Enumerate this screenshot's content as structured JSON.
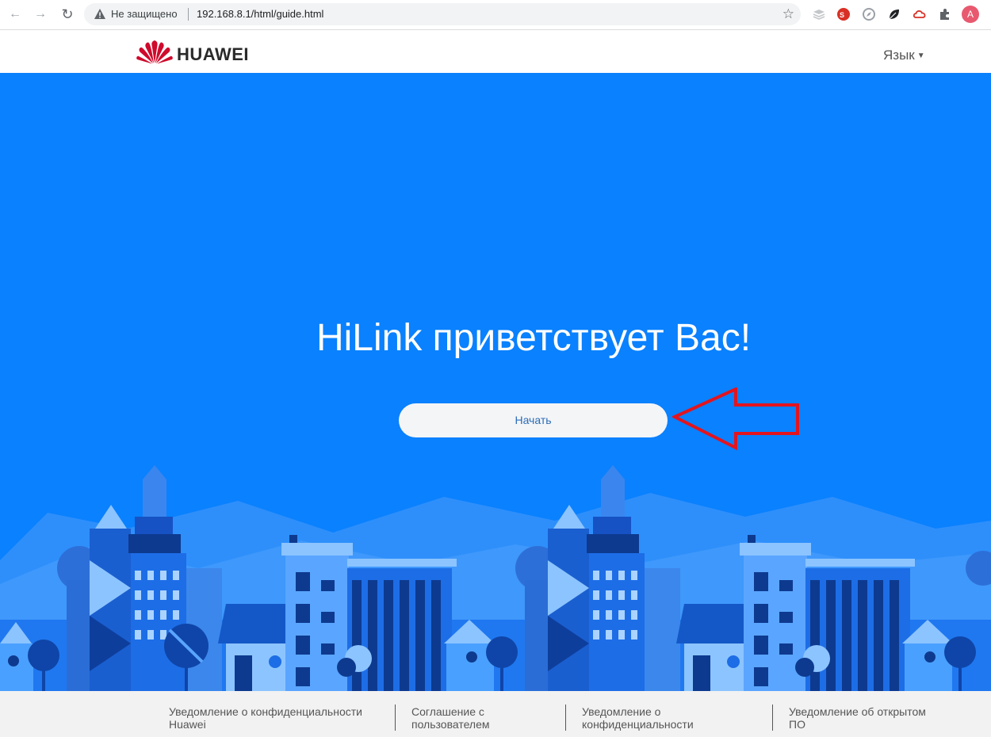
{
  "browser": {
    "security_status": "Не защищено",
    "url": "192.168.8.1/html/guide.html",
    "avatar_letter": "A"
  },
  "header": {
    "brand": "HUAWEI",
    "language_label": "Язык"
  },
  "hero": {
    "title": "HiLink приветствует Вас!",
    "start_label": "Начать"
  },
  "footer": {
    "links": [
      {
        "line1": "Уведомление о конфиденциальности",
        "line2": "Huawei"
      },
      {
        "line1": "Соглашение с",
        "line2": "пользователем"
      },
      {
        "line1": "Уведомление о",
        "line2": "конфиденциальности"
      },
      {
        "line1": "Уведомление об открытом",
        "line2": "ПО"
      }
    ]
  },
  "colors": {
    "hero_bg": "#0a81fe",
    "accent_red": "#e3141e",
    "brand_red": "#cf0a2c"
  },
  "icons": [
    "back-icon",
    "forward-icon",
    "reload-icon",
    "warning-icon",
    "star-icon",
    "extension-icon",
    "huawei-logo",
    "caret-down-icon",
    "arrow-annotation"
  ]
}
